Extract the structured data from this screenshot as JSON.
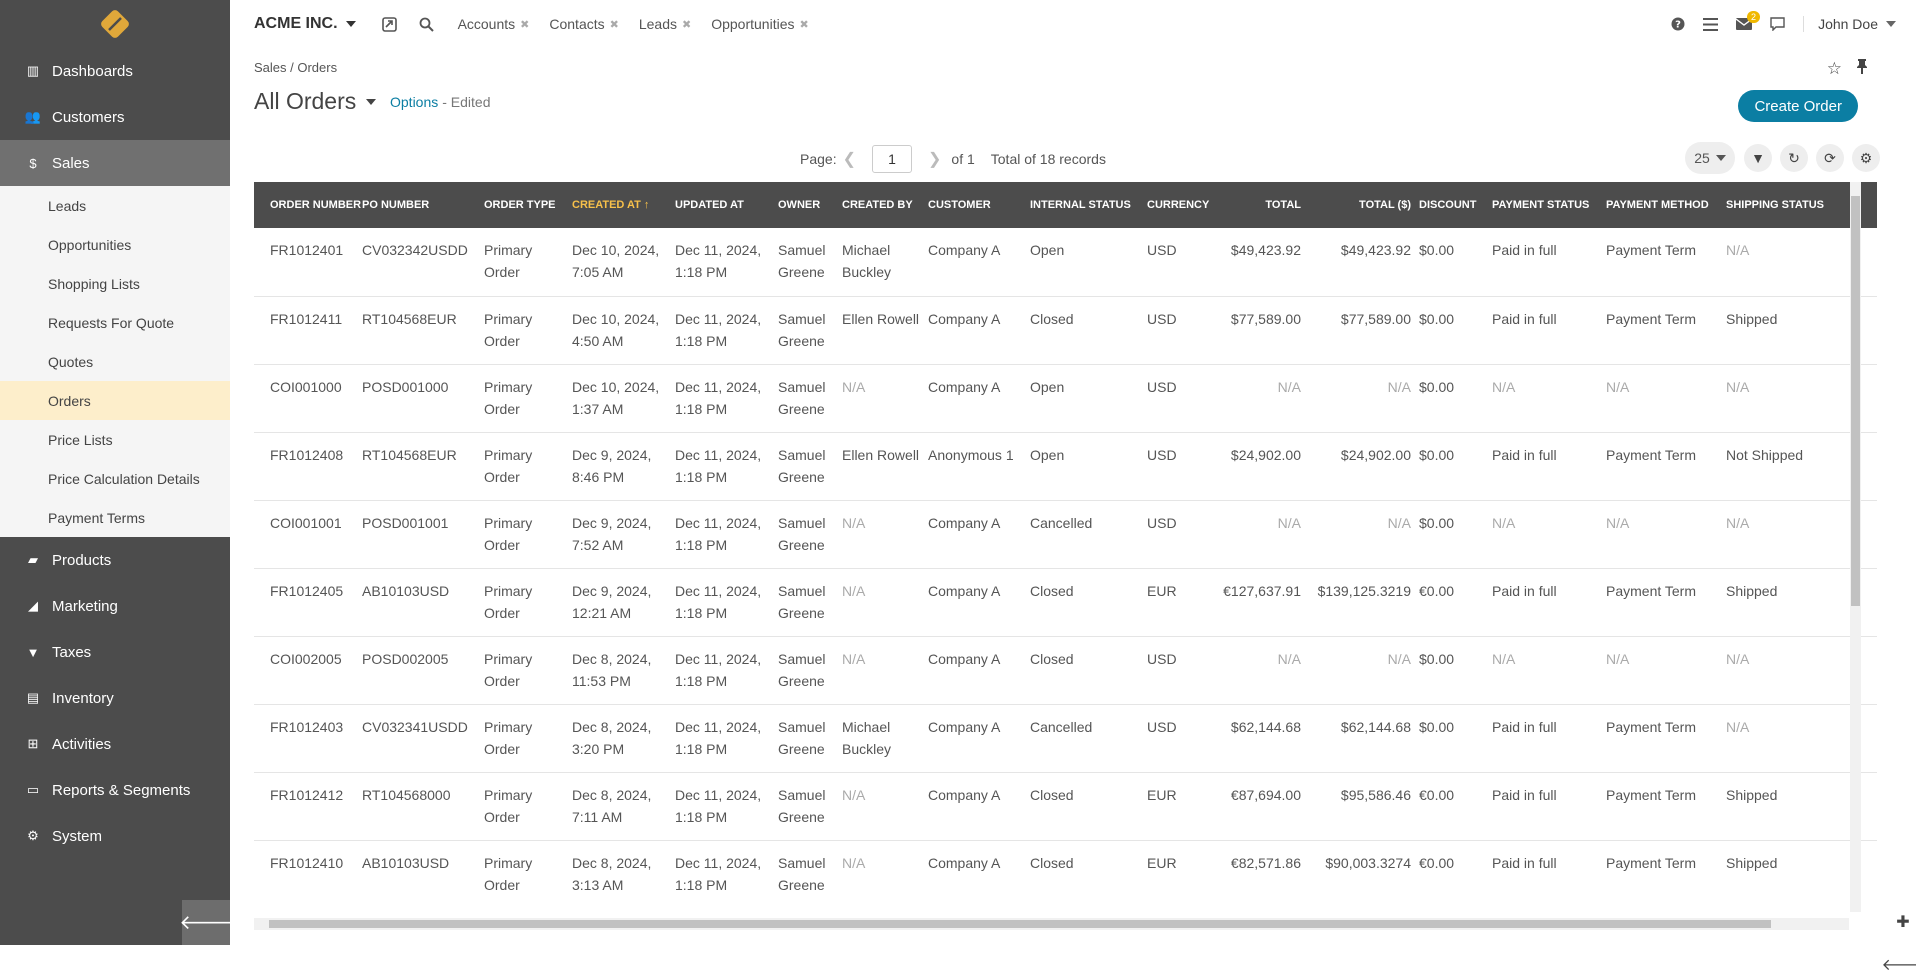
{
  "app": {
    "org_name": "ACME INC.",
    "user": "John Doe",
    "notifications_count": "2"
  },
  "topbar": {
    "shortcuts": [
      "Accounts",
      "Contacts",
      "Leads",
      "Opportunities"
    ]
  },
  "sidebar": {
    "items": [
      {
        "label": "Dashboards",
        "icon": "bar-chart-icon"
      },
      {
        "label": "Customers",
        "icon": "users-icon"
      },
      {
        "label": "Sales",
        "icon": "dollar-icon"
      },
      {
        "label": "Products",
        "icon": "briefcase-icon"
      },
      {
        "label": "Marketing",
        "icon": "bullhorn-icon"
      },
      {
        "label": "Taxes",
        "icon": "filter-icon"
      },
      {
        "label": "Inventory",
        "icon": "list-icon"
      },
      {
        "label": "Activities",
        "icon": "sitemap-icon"
      },
      {
        "label": "Reports & Segments",
        "icon": "folder-icon"
      },
      {
        "label": "System",
        "icon": "gear-icon"
      }
    ],
    "sales_sub": [
      "Leads",
      "Opportunities",
      "Shopping Lists",
      "Requests For Quote",
      "Quotes",
      "Orders",
      "Price Lists",
      "Price Calculation Details",
      "Payment Terms"
    ]
  },
  "page": {
    "breadcrumb": "Sales / Orders",
    "title": "All Orders",
    "options_label": "Options",
    "edited_label": "- Edited",
    "create_button": "Create Order"
  },
  "pager": {
    "page_label": "Page:",
    "page_value": "1",
    "of_label": "of 1",
    "total_label": "Total of 18 records",
    "per_page": "25"
  },
  "table": {
    "columns": [
      "ORDER NUMBER",
      "PO NUMBER",
      "ORDER TYPE",
      "CREATED AT",
      "UPDATED AT",
      "OWNER",
      "CREATED BY",
      "CUSTOMER",
      "INTERNAL STATUS",
      "CURRENCY",
      "TOTAL",
      "TOTAL ($)",
      "DISCOUNT",
      "PAYMENT STATUS",
      "PAYMENT METHOD",
      "SHIPPING STATUS"
    ],
    "rows": [
      [
        "FR1012401",
        "CV032342USDD",
        "Primary Order",
        "Dec 10, 2024, 7:05 AM",
        "Dec 11, 2024, 1:18 PM",
        "Samuel Greene",
        "Michael Buckley",
        "Company A",
        "Open",
        "USD",
        "$49,423.92",
        "$49,423.92",
        "$0.00",
        "Paid in full",
        "Payment Term",
        "N/A"
      ],
      [
        "FR1012411",
        "RT104568EUR",
        "Primary Order",
        "Dec 10, 2024, 4:50 AM",
        "Dec 11, 2024, 1:18 PM",
        "Samuel Greene",
        "Ellen Rowell",
        "Company A",
        "Closed",
        "USD",
        "$77,589.00",
        "$77,589.00",
        "$0.00",
        "Paid in full",
        "Payment Term",
        "Shipped"
      ],
      [
        "COI001000",
        "POSD001000",
        "Primary Order",
        "Dec 10, 2024, 1:37 AM",
        "Dec 11, 2024, 1:18 PM",
        "Samuel Greene",
        "N/A",
        "Company A",
        "Open",
        "USD",
        "N/A",
        "N/A",
        "$0.00",
        "N/A",
        "N/A",
        "N/A"
      ],
      [
        "FR1012408",
        "RT104568EUR",
        "Primary Order",
        "Dec 9, 2024, 8:46 PM",
        "Dec 11, 2024, 1:18 PM",
        "Samuel Greene",
        "Ellen Rowell",
        "Anonymous 1",
        "Open",
        "USD",
        "$24,902.00",
        "$24,902.00",
        "$0.00",
        "Paid in full",
        "Payment Term",
        "Not Shipped"
      ],
      [
        "COI001001",
        "POSD001001",
        "Primary Order",
        "Dec 9, 2024, 7:52 AM",
        "Dec 11, 2024, 1:18 PM",
        "Samuel Greene",
        "N/A",
        "Company A",
        "Cancelled",
        "USD",
        "N/A",
        "N/A",
        "$0.00",
        "N/A",
        "N/A",
        "N/A"
      ],
      [
        "FR1012405",
        "AB10103USD",
        "Primary Order",
        "Dec 9, 2024, 12:21 AM",
        "Dec 11, 2024, 1:18 PM",
        "Samuel Greene",
        "N/A",
        "Company A",
        "Closed",
        "EUR",
        "€127,637.91",
        "$139,125.3219",
        "€0.00",
        "Paid in full",
        "Payment Term",
        "Shipped"
      ],
      [
        "COI002005",
        "POSD002005",
        "Primary Order",
        "Dec 8, 2024, 11:53 PM",
        "Dec 11, 2024, 1:18 PM",
        "Samuel Greene",
        "N/A",
        "Company A",
        "Closed",
        "USD",
        "N/A",
        "N/A",
        "$0.00",
        "N/A",
        "N/A",
        "N/A"
      ],
      [
        "FR1012403",
        "CV032341USDD",
        "Primary Order",
        "Dec 8, 2024, 3:20 PM",
        "Dec 11, 2024, 1:18 PM",
        "Samuel Greene",
        "Michael Buckley",
        "Company A",
        "Cancelled",
        "USD",
        "$62,144.68",
        "$62,144.68",
        "$0.00",
        "Paid in full",
        "Payment Term",
        "N/A"
      ],
      [
        "FR1012412",
        "RT104568000",
        "Primary Order",
        "Dec 8, 2024, 7:11 AM",
        "Dec 11, 2024, 1:18 PM",
        "Samuel Greene",
        "N/A",
        "Company A",
        "Closed",
        "EUR",
        "€87,694.00",
        "$95,586.46",
        "€0.00",
        "Paid in full",
        "Payment Term",
        "Shipped"
      ],
      [
        "FR1012410",
        "AB10103USD",
        "Primary Order",
        "Dec 8, 2024, 3:13 AM",
        "Dec 11, 2024, 1:18 PM",
        "Samuel Greene",
        "N/A",
        "Company A",
        "Closed",
        "EUR",
        "€82,571.86",
        "$90,003.3274",
        "€0.00",
        "Paid in full",
        "Payment Term",
        "Shipped"
      ]
    ]
  },
  "colors": {
    "accent": "#0b7ea3",
    "sidebar": "#4c4c4c",
    "sorted": "#f7c04a"
  }
}
